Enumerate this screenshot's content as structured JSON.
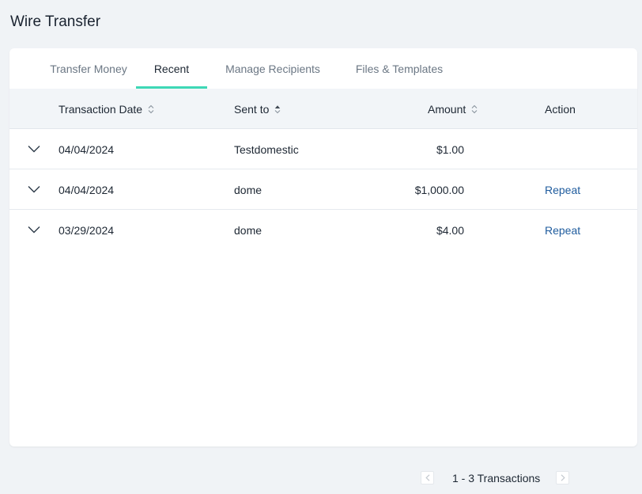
{
  "page": {
    "title": "Wire Transfer"
  },
  "tabs": [
    {
      "label": "Transfer Money",
      "active": false
    },
    {
      "label": "Recent",
      "active": true
    },
    {
      "label": "Manage Recipients",
      "active": false
    },
    {
      "label": "Files & Templates",
      "active": false
    }
  ],
  "table": {
    "columns": {
      "date": "Transaction Date",
      "sent_to": "Sent to",
      "amount": "Amount",
      "action": "Action"
    },
    "sort": {
      "active_column": "sent_to"
    },
    "rows": [
      {
        "date": "04/04/2024",
        "sent_to": "Testdomestic",
        "amount": "$1.00",
        "action": ""
      },
      {
        "date": "04/04/2024",
        "sent_to": "dome",
        "amount": "$1,000.00",
        "action": "Repeat"
      },
      {
        "date": "03/29/2024",
        "sent_to": "dome",
        "amount": "$4.00",
        "action": "Repeat"
      }
    ]
  },
  "pagination": {
    "label": "1 - 3 Transactions"
  },
  "colors": {
    "accent": "#3ed8b6",
    "link": "#1f5c9e",
    "background": "#f0f3f6"
  }
}
